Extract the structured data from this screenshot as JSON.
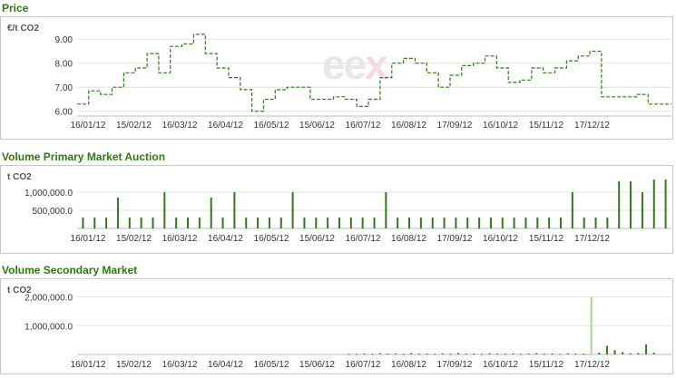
{
  "sections": {
    "price": {
      "title": "Price",
      "unit": "€/t CO2"
    },
    "primary": {
      "title": "Volume Primary Market Auction",
      "unit": "t CO2"
    },
    "secondary": {
      "title": "Volume Secondary Market",
      "unit": "t CO2"
    }
  },
  "logo": {
    "text": "ee",
    "x_part": "x"
  },
  "colors": {
    "title": "#2c7a12",
    "series": "#2e7d18",
    "secondary_light": "#a8d890",
    "grid": "#e4e4e4"
  },
  "chart_data": [
    {
      "type": "line",
      "title": "Price",
      "ylabel": "€/t CO2",
      "ylim": [
        5.8,
        9.5
      ],
      "y_ticks": [
        "6.00",
        "7.00",
        "8.00",
        "9.00"
      ],
      "x_ticks": [
        "16/01/12",
        "15/02/12",
        "16/03/12",
        "16/04/12",
        "16/05/12",
        "15/06/12",
        "16/07/12",
        "16/08/12",
        "17/09/12",
        "16/10/12",
        "15/11/12",
        "17/12/12"
      ],
      "style": "dashed step",
      "series": [
        {
          "values": [
            6.3,
            6.85,
            6.7,
            7.0,
            7.6,
            7.8,
            8.4,
            7.6,
            8.7,
            8.8,
            9.2,
            8.4,
            7.8,
            7.4,
            6.9,
            6.0,
            6.5,
            6.9,
            7.0,
            7.0,
            6.5,
            6.5,
            6.6,
            6.5,
            6.2,
            6.5,
            7.4,
            8.0,
            8.2,
            8.0,
            7.6,
            7.0,
            7.5,
            7.9,
            8.0,
            8.3,
            7.8,
            7.2,
            7.3,
            7.8,
            7.6,
            7.8,
            8.1,
            8.3,
            8.5,
            6.6,
            6.6,
            6.6,
            6.7,
            6.3,
            6.3
          ]
        }
      ]
    },
    {
      "type": "bar",
      "title": "Volume Primary Market Auction",
      "ylabel": "t CO2",
      "ylim": [
        0,
        1400000
      ],
      "y_ticks": [
        "500,000.0",
        "1,000,000.0"
      ],
      "x_ticks": [
        "16/01/12",
        "15/02/12",
        "16/03/12",
        "16/04/12",
        "16/05/12",
        "15/06/12",
        "16/07/12",
        "16/08/12",
        "17/09/12",
        "16/10/12",
        "15/11/12",
        "17/12/12"
      ],
      "values": [
        300000,
        300000,
        300000,
        850000,
        300000,
        300000,
        300000,
        1000000,
        300000,
        300000,
        300000,
        850000,
        300000,
        1000000,
        300000,
        300000,
        300000,
        300000,
        1000000,
        300000,
        300000,
        300000,
        300000,
        300000,
        300000,
        300000,
        1000000,
        300000,
        300000,
        300000,
        300000,
        300000,
        300000,
        300000,
        300000,
        300000,
        300000,
        300000,
        300000,
        300000,
        300000,
        300000,
        1000000,
        300000,
        300000,
        300000,
        1300000,
        1300000,
        1000000,
        1350000,
        1350000
      ]
    },
    {
      "type": "bar",
      "title": "Volume Secondary Market",
      "ylabel": "t CO2",
      "ylim": [
        0,
        2300000
      ],
      "y_ticks": [
        "1,000,000.0",
        "2,000,000.0"
      ],
      "x_ticks": [
        "16/01/12",
        "15/02/12",
        "16/03/12",
        "16/04/12",
        "16/05/12",
        "15/06/12",
        "16/07/12",
        "16/08/12",
        "17/09/12",
        "16/10/12",
        "15/11/12",
        "17/12/12"
      ],
      "values": [
        20000,
        15000,
        30000,
        20000,
        40000,
        25000,
        30000,
        20000,
        45000,
        25000,
        30000,
        20000,
        35000,
        25000,
        50000,
        30000,
        25000,
        20000,
        40000,
        30000,
        25000,
        35000,
        20000,
        30000,
        45000,
        25000,
        30000,
        20000,
        40000,
        30000,
        25000,
        2000000,
        60000,
        300000,
        150000,
        80000,
        40000,
        50000,
        350000,
        60000
      ]
    }
  ]
}
